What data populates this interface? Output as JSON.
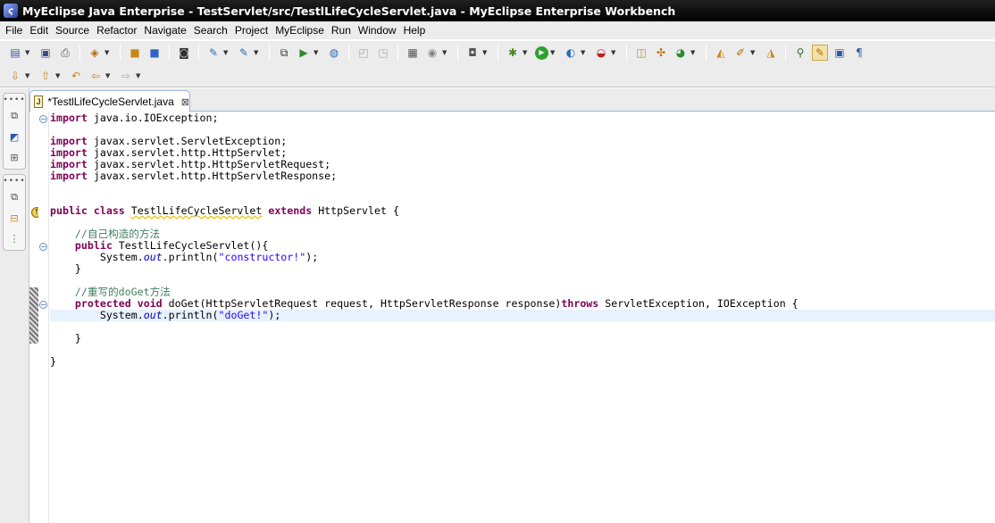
{
  "window": {
    "title": "MyEclipse Java Enterprise - TestServlet/src/TestlLifeCycleServlet.java - MyEclipse Enterprise Workbench"
  },
  "menu": [
    "File",
    "Edit",
    "Source",
    "Refactor",
    "Navigate",
    "Search",
    "Project",
    "MyEclipse",
    "Run",
    "Window",
    "Help"
  ],
  "editor": {
    "tab_label": "*TestlLifeCycleServlet.java",
    "code": {
      "l1_kw": "import",
      "l1_rest": " java.io.IOException;",
      "l2_kw": "import",
      "l2_rest": " javax.servlet.ServletException;",
      "l3_kw": "import",
      "l3_rest": " javax.servlet.http.HttpServlet;",
      "l4_kw": "import",
      "l4_rest": " javax.servlet.http.HttpServletRequest;",
      "l5_kw": "import",
      "l5_rest": " javax.servlet.http.HttpServletResponse;",
      "l6_kw1": "public",
      "l6_kw2": "class",
      "l6_name": "TestlLifeCycleServlet",
      "l6_kw3": "extends",
      "l6_rest": " HttpServlet {",
      "l7_cmt": "//自己构造的方法",
      "l8_kw": "public",
      "l8_rest": " TestlLifeCycleServlet(){",
      "l9_a": "System.",
      "l9_out": "out",
      "l9_b": ".println(",
      "l9_str": "\"constructor!\"",
      "l9_c": ");",
      "l10": "}",
      "l11_cmt": "//重写的doGet方法",
      "l12_kw1": "protected",
      "l12_kw2": "void",
      "l12_mid": " doGet(HttpServletRequest request, HttpServletResponse response)",
      "l12_kw3": "throws",
      "l12_rest": " ServletException, IOException {",
      "l13_a": "System.",
      "l13_out": "out",
      "l13_b": ".println(",
      "l13_str": "\"doGet!\"",
      "l13_c": ");",
      "l14": "}",
      "l15": "}"
    }
  },
  "colors": {
    "keyword": "#7f0055",
    "string": "#2a00ff",
    "comment": "#3f7f5f",
    "current_line": "#e8f2fe"
  }
}
